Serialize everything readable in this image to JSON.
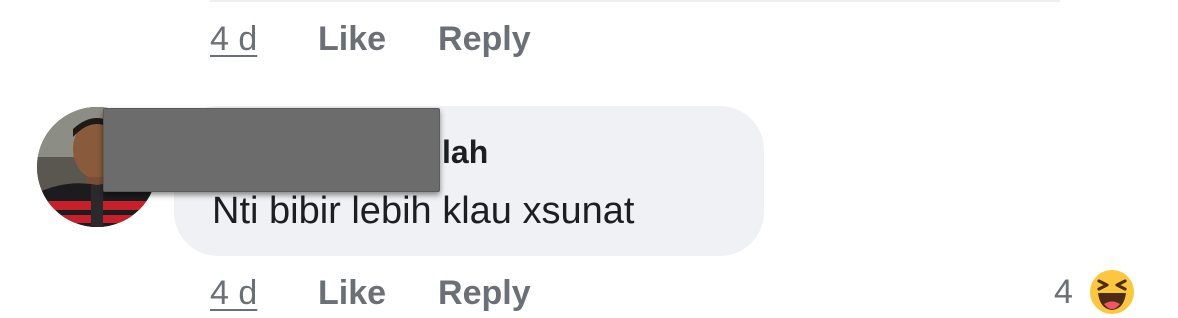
{
  "previous_comment": {
    "timestamp": "4 d",
    "like_label": "Like",
    "reply_label": "Reply"
  },
  "comment": {
    "author_visible_suffix": "lah",
    "text": "Nti bibir lebih klau xsunat",
    "timestamp": "4 d",
    "like_label": "Like",
    "reply_label": "Reply",
    "reaction_count": "4",
    "reaction_icon": "haha-reaction-icon"
  },
  "colors": {
    "bubble": "#f0f1f4",
    "secondary_text": "#6b6f76",
    "primary_text": "#1c1e21",
    "redaction": "#6c6c6c",
    "reaction_yellow": "#fcc73d"
  }
}
